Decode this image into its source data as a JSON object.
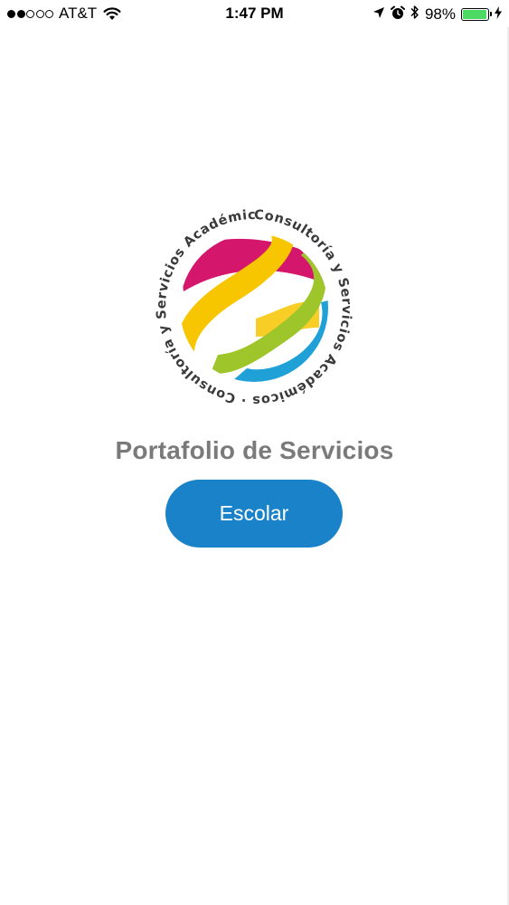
{
  "status_bar": {
    "signal_dots_filled": 2,
    "signal_dots_total": 5,
    "carrier": "AT&T",
    "time": "1:47 PM",
    "battery_percent": "98%",
    "battery_level": 0.98,
    "icons": [
      "wifi-icon",
      "location-arrow-icon",
      "alarm-icon",
      "bluetooth-icon",
      "battery-icon",
      "charging-bolt-icon"
    ]
  },
  "logo": {
    "ring_text": "Consultoría y Servicios Académicos · Consultoría y Servicios Académicos ·",
    "colors": [
      "#d4166d",
      "#f7c600",
      "#9ec62a",
      "#1fa1d8"
    ]
  },
  "main": {
    "title": "Portafolio de Servicios",
    "button_label": "Escolar",
    "button_color": "#1982c8",
    "title_color": "#7a7a7a"
  }
}
